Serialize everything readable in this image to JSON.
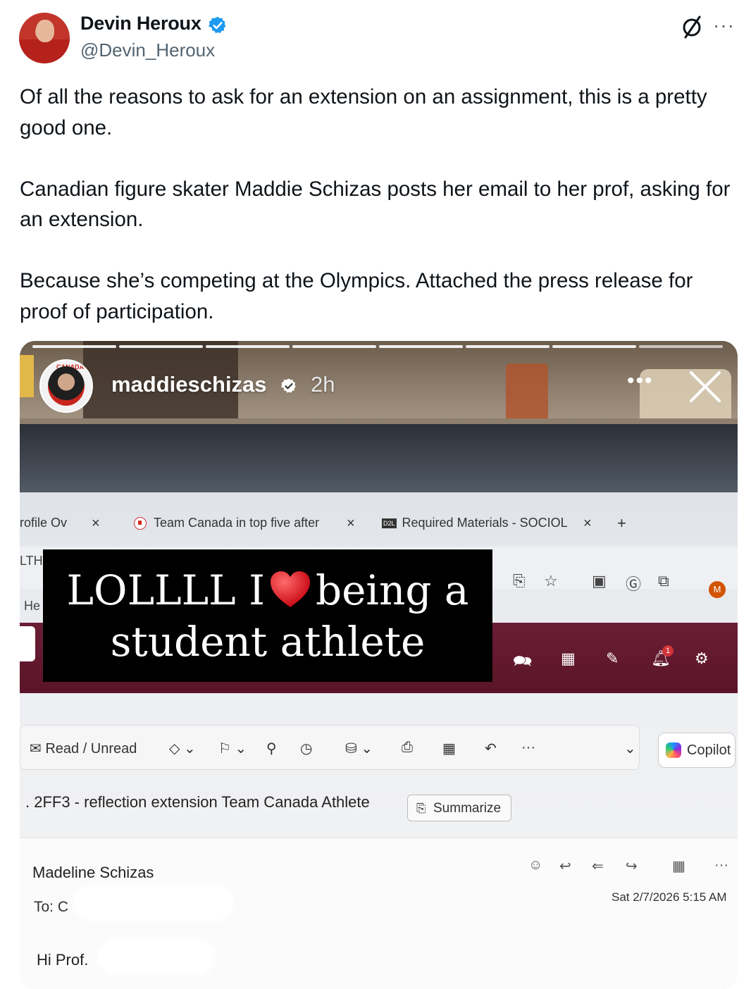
{
  "tweet": {
    "author_name": "Devin Heroux",
    "author_handle": "@Devin_Heroux",
    "text_paragraphs": [
      "Of all the reasons to ask for an extension on an assignment, this is a pretty good one.",
      "Canadian figure skater Maddie Schizas posts her email to her prof, asking for an extension.",
      "Because she’s competing at the Olympics. Attached the press release for proof of participation."
    ],
    "more_label": "···",
    "verified_color": "#1d9bf0"
  },
  "story": {
    "username": "maddieschizas",
    "time": "2h",
    "more_label": "•••",
    "avatar_tag": "CANADA",
    "caption_line1_before": "LOLLLL I",
    "caption_line1_after": "being a",
    "caption_line2": "student athlete"
  },
  "browser": {
    "tabs": [
      {
        "label": "rofile Ov"
      },
      {
        "label": "Team Canada in top five after"
      },
      {
        "label": "Required Materials - SOCIOL"
      }
    ],
    "tab_close": "×",
    "tab_add": "+",
    "d2l_badge": "D2L",
    "side_text_top": "LTH",
    "side_text_bottom": "He",
    "profile_initial": "M",
    "notification_count": "1"
  },
  "outlook": {
    "ribbon": {
      "read_unread": "Read / Unread",
      "more": "···",
      "copilot": "Copilot"
    },
    "subject": ". 2FF3 - reflection extension Team Canada Athlete",
    "summarize_label": "Summarize",
    "sender": "Madeline Schizas",
    "to_label": "To: C",
    "date": "Sat 2/7/2026 5:15 AM",
    "greeting": "Hi Prof.",
    "actions_more": "···"
  }
}
